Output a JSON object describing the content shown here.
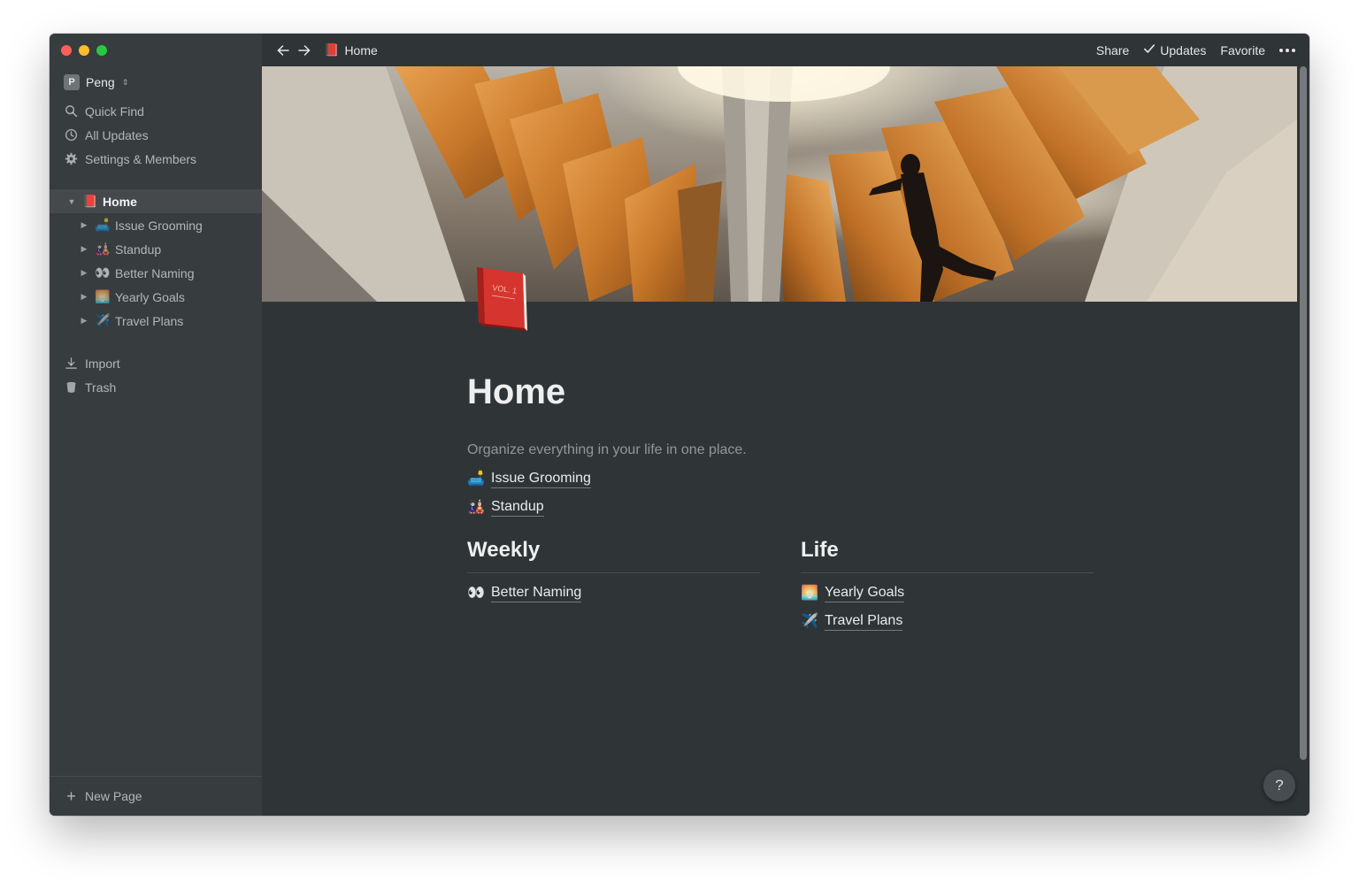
{
  "sidebar": {
    "workspace": {
      "avatar_letter": "P",
      "name": "Peng",
      "chevron": "⇕"
    },
    "menu": [
      {
        "label": "Quick Find",
        "icon": "search-icon"
      },
      {
        "label": "All Updates",
        "icon": "clock-icon"
      },
      {
        "label": "Settings & Members",
        "icon": "gear-icon"
      }
    ],
    "tree": [
      {
        "label": "Home",
        "emoji": "📕",
        "active": true,
        "expanded": true
      },
      {
        "label": "Issue Grooming",
        "emoji": "🛋️"
      },
      {
        "label": "Standup",
        "emoji": "🎎"
      },
      {
        "label": "Better Naming",
        "emoji": "👀"
      },
      {
        "label": "Yearly Goals",
        "emoji": "🌅"
      },
      {
        "label": "Travel Plans",
        "emoji": "✈️"
      }
    ],
    "bottom": [
      {
        "label": "Import",
        "icon": "download-icon"
      },
      {
        "label": "Trash",
        "icon": "trash-icon"
      }
    ],
    "new_page": "New Page"
  },
  "topbar": {
    "breadcrumb_emoji": "📕",
    "breadcrumb": "Home",
    "share": "Share",
    "updates": "Updates",
    "favorite": "Favorite"
  },
  "page": {
    "title": "Home",
    "subtitle": "Organize everything in your life in one place.",
    "links": [
      {
        "emoji": "🛋️",
        "label": "Issue Grooming"
      },
      {
        "emoji": "🎎",
        "label": "Standup"
      }
    ],
    "columns": [
      {
        "heading": "Weekly",
        "links": [
          {
            "emoji": "👀",
            "label": "Better Naming"
          }
        ]
      },
      {
        "heading": "Life",
        "links": [
          {
            "emoji": "🌅",
            "label": "Yearly Goals"
          },
          {
            "emoji": "✈️",
            "label": "Travel Plans"
          }
        ]
      }
    ],
    "book_label": "VOL. 1"
  },
  "help": "?",
  "colors": {
    "sidebar_bg": "#373c3f",
    "main_bg": "#2f3437",
    "accent_book": "#d6352f"
  }
}
